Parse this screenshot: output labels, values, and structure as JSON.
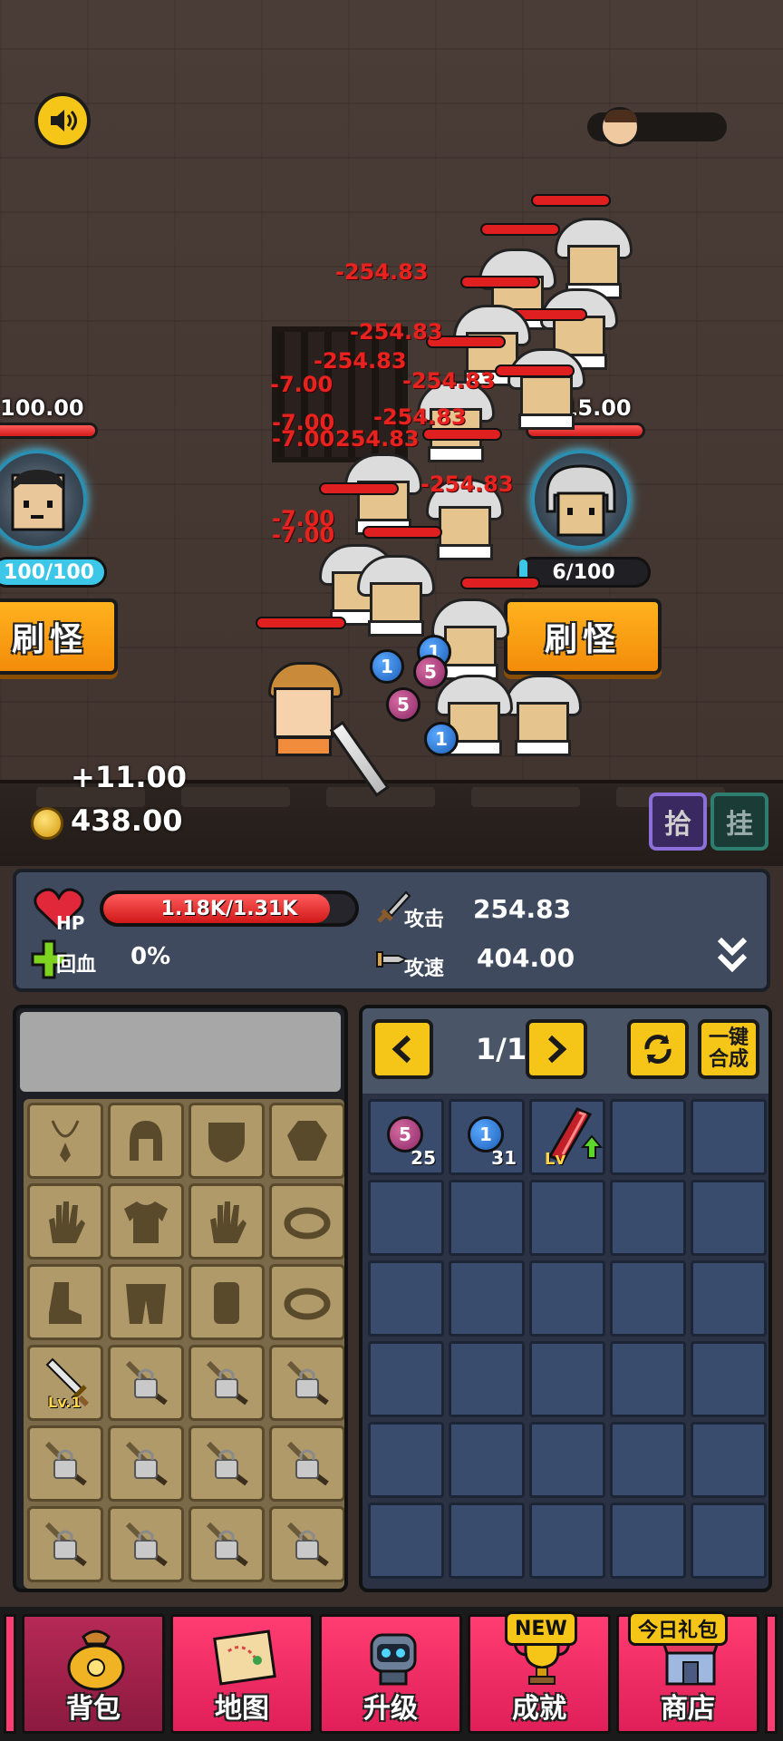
{
  "scene": {
    "left_spawner": {
      "count_label": "100.00",
      "capacity": "100/100",
      "capacity_fraction": 1.0,
      "button_label": "刷怪"
    },
    "right_spawner": {
      "count_label": "515.00",
      "capacity": "6/100",
      "capacity_fraction": 0.06,
      "button_label": "刷怪"
    },
    "damage_texts": [
      "-254.83",
      "-254.83",
      "-254.83",
      "-7.00",
      "-254.83",
      "-254.83",
      "-7.00",
      "-7.00",
      "254.83",
      "-254.83",
      "-7.00",
      "-7.00"
    ],
    "orbs": [
      {
        "value": "1",
        "color": "blue"
      },
      {
        "value": "1",
        "color": "blue"
      },
      {
        "value": "5",
        "color": "purple"
      },
      {
        "value": "5",
        "color": "purple"
      },
      {
        "value": "1",
        "color": "blue"
      }
    ],
    "gain": "+11.00",
    "coins": "438.00",
    "pick_button": "拾",
    "idle_button": "挂"
  },
  "stats": {
    "hp_label": "HP",
    "hp_value": "1.18K/1.31K",
    "hp_fraction": 0.9,
    "regen_label": "回血",
    "regen_value": "0%",
    "attack_label": "攻击",
    "attack_value": "254.83",
    "speed_label": "攻速",
    "speed_value": "404.00"
  },
  "equipment": {
    "slots": [
      {
        "icon": "necklace-icon"
      },
      {
        "icon": "helmet-icon"
      },
      {
        "icon": "shield-icon"
      },
      {
        "icon": "gem-icon"
      },
      {
        "icon": "glove-icon"
      },
      {
        "icon": "armor-icon"
      },
      {
        "icon": "glove-icon"
      },
      {
        "icon": "ring-icon"
      },
      {
        "icon": "boot-icon"
      },
      {
        "icon": "pants-icon"
      },
      {
        "icon": "bracer-icon"
      },
      {
        "icon": "ring-icon"
      },
      {
        "icon": "sword-icon",
        "level": "Lv.1"
      },
      {
        "icon": "locked-weapon-icon"
      },
      {
        "icon": "locked-weapon-icon"
      },
      {
        "icon": "locked-weapon-icon"
      },
      {
        "icon": "locked-weapon-icon"
      },
      {
        "icon": "locked-weapon-icon"
      },
      {
        "icon": "locked-weapon-icon"
      },
      {
        "icon": "locked-weapon-icon"
      },
      {
        "icon": "locked-weapon-icon"
      },
      {
        "icon": "locked-weapon-icon"
      },
      {
        "icon": "locked-weapon-icon"
      },
      {
        "icon": "locked-weapon-icon"
      }
    ]
  },
  "inventory": {
    "page": "1/1",
    "merge_label_line1": "一键",
    "merge_label_line2": "合成",
    "items": [
      {
        "type": "orb",
        "color": "purple",
        "value": "5",
        "qty": "25"
      },
      {
        "type": "orb",
        "color": "blue",
        "value": "1",
        "qty": "31"
      },
      {
        "type": "crystal",
        "level_text": "Lv"
      }
    ]
  },
  "nav": {
    "items": [
      {
        "label": "背包",
        "icon": "bag-icon"
      },
      {
        "label": "地图",
        "icon": "map-icon"
      },
      {
        "label": "升级",
        "icon": "robot-icon"
      },
      {
        "label": "成就",
        "icon": "trophy-icon",
        "badge": "NEW"
      },
      {
        "label": "商店",
        "icon": "shop-icon",
        "badge": "今日礼包"
      }
    ]
  },
  "colors": {
    "accent_yellow": "#f5c518",
    "spawn_orange": "#f38c0a",
    "nav_pink": "#ff3d72",
    "damage_red": "#e8231f"
  }
}
